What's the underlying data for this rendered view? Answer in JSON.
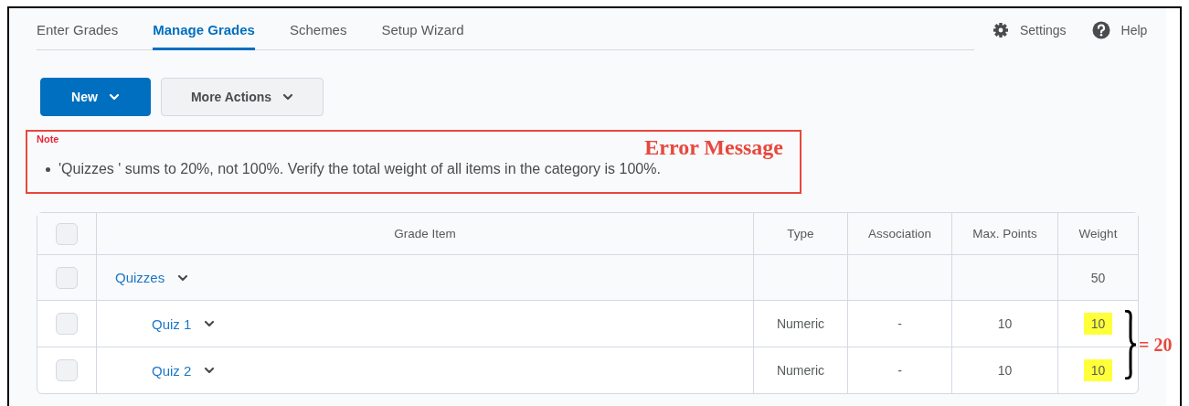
{
  "tabs": [
    {
      "label": "Enter Grades",
      "selected": false
    },
    {
      "label": "Manage Grades",
      "selected": true
    },
    {
      "label": "Schemes",
      "selected": false
    },
    {
      "label": "Setup Wizard",
      "selected": false
    }
  ],
  "header_links": [
    {
      "kind": "settings",
      "label": "Settings"
    },
    {
      "kind": "help",
      "label": "Help"
    }
  ],
  "buttons": [
    {
      "label": "New",
      "kind": "primary"
    },
    {
      "label": "More Actions",
      "kind": "secondary"
    }
  ],
  "note": {
    "title": "Note",
    "annotation": "Error Message",
    "messages": [
      "'Quizzes ' sums to 20%, not 100%. Verify the total weight of all items in the category is 100%."
    ]
  },
  "table": {
    "select_all_checked": false,
    "columns": [
      "Grade Item",
      "Type",
      "Association",
      "Max. Points",
      "Weight"
    ],
    "rows": [
      {
        "kind": "category",
        "checked": false,
        "name": "Quizzes",
        "type": "",
        "association": "",
        "max_points": "",
        "weight": "50",
        "highlighted": false
      },
      {
        "kind": "item",
        "checked": false,
        "name": "Quiz 1",
        "type": "Numeric",
        "association": "-",
        "max_points": "10",
        "weight": "10",
        "highlighted": true
      },
      {
        "kind": "item",
        "checked": false,
        "name": "Quiz 2",
        "type": "Numeric",
        "association": "-",
        "max_points": "10",
        "weight": "10",
        "highlighted": true
      }
    ]
  },
  "sum_annotation": "= 20"
}
